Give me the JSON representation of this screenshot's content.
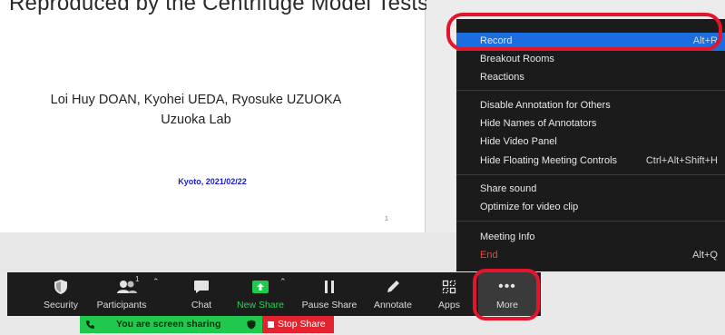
{
  "slide": {
    "title": "Reproduced by the Centrifuge Model Tests?",
    "authors": "Loi Huy DOAN, Kyohei UEDA, Ryosuke UZUOKA",
    "lab": "Uzuoka Lab",
    "date": "Kyoto, 2021/02/22",
    "page_number": "1"
  },
  "menu": {
    "items": [
      {
        "label": "Record",
        "shortcut": "Alt+R"
      },
      {
        "label": "Breakout Rooms",
        "shortcut": ""
      },
      {
        "label": "Reactions",
        "shortcut": ""
      },
      {
        "label": "Disable Annotation for Others",
        "shortcut": ""
      },
      {
        "label": "Hide Names of Annotators",
        "shortcut": ""
      },
      {
        "label": "Hide Video Panel",
        "shortcut": ""
      },
      {
        "label": "Hide Floating Meeting Controls",
        "shortcut": "Ctrl+Alt+Shift+H"
      },
      {
        "label": "Share sound",
        "shortcut": ""
      },
      {
        "label": "Optimize for video clip",
        "shortcut": ""
      },
      {
        "label": "Meeting Info",
        "shortcut": ""
      },
      {
        "label": "End",
        "shortcut": "Alt+Q"
      }
    ]
  },
  "toolbar": {
    "security": "Security",
    "participants": "Participants",
    "participant_count": "1",
    "chat": "Chat",
    "new_share": "New Share",
    "pause_share": "Pause Share",
    "annotate": "Annotate",
    "apps": "Apps",
    "more": "More"
  },
  "sharing": {
    "status": "You are screen sharing",
    "stop": "Stop Share"
  },
  "colors": {
    "menu_bg": "#1b1b1b",
    "highlight": "#1a6ee0",
    "end_red": "#e8483c",
    "annotation_red": "#e3142b",
    "share_green": "#20c94d",
    "stop_red": "#e3232f"
  },
  "icons": [
    "shield-icon",
    "participants-icon",
    "chat-icon",
    "share-up-arrow-icon",
    "pause-icon",
    "pen-icon",
    "apps-icon",
    "more-dots-icon",
    "phone-icon",
    "shield-small-icon"
  ]
}
